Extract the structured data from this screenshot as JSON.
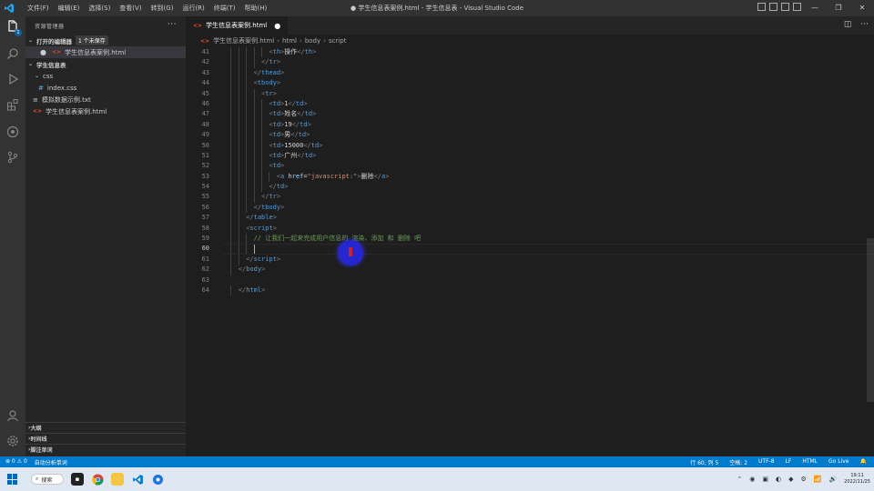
{
  "titlebar": {
    "menu": [
      "文件(F)",
      "编辑(E)",
      "选择(S)",
      "查看(V)",
      "转到(G)",
      "运行(R)",
      "终端(T)",
      "帮助(H)"
    ],
    "title": "● 学生信息表案例.html - 学生信息表 - Visual Studio Code"
  },
  "sidebar": {
    "title": "资源管理器",
    "open_editors": {
      "label": "打开的编辑器",
      "unsaved": "1 个未保存",
      "file": "学生信息表案例.html"
    },
    "project": {
      "label": "学生信息表",
      "folder": "css",
      "files": [
        "index.css",
        "模拟数据示例.txt",
        "学生信息表案例.html"
      ]
    },
    "bottom": [
      "大纲",
      "时间线",
      "脚注单词"
    ]
  },
  "editor": {
    "tab": "学生信息表案例.html",
    "breadcrumb": [
      "学生信息表案例.html",
      "html",
      "body",
      "script"
    ],
    "lines": [
      {
        "n": "41",
        "indent": 6,
        "html": "<span class=\"br\">&lt;</span><span class=\"tag\">th</span><span class=\"br\">&gt;</span>操作<span class=\"br\">&lt;/</span><span class=\"tag\">th</span><span class=\"br\">&gt;</span>"
      },
      {
        "n": "42",
        "indent": 5,
        "html": "<span class=\"br\">&lt;/</span><span class=\"tag\">tr</span><span class=\"br\">&gt;</span>"
      },
      {
        "n": "43",
        "indent": 4,
        "html": "<span class=\"br\">&lt;/</span><span class=\"tag\">thead</span><span class=\"br\">&gt;</span>"
      },
      {
        "n": "44",
        "indent": 4,
        "html": "<span class=\"br\">&lt;</span><span class=\"tag\">tbody</span><span class=\"br\">&gt;</span>"
      },
      {
        "n": "45",
        "indent": 5,
        "html": "<span class=\"br\">&lt;</span><span class=\"tag\">tr</span><span class=\"br\">&gt;</span>"
      },
      {
        "n": "46",
        "indent": 6,
        "html": "<span class=\"br\">&lt;</span><span class=\"tag\">td</span><span class=\"br\">&gt;</span>1<span class=\"br\">&lt;/</span><span class=\"tag\">td</span><span class=\"br\">&gt;</span>"
      },
      {
        "n": "47",
        "indent": 6,
        "html": "<span class=\"br\">&lt;</span><span class=\"tag\">td</span><span class=\"br\">&gt;</span>姓名<span class=\"br\">&lt;/</span><span class=\"tag\">td</span><span class=\"br\">&gt;</span>"
      },
      {
        "n": "48",
        "indent": 6,
        "html": "<span class=\"br\">&lt;</span><span class=\"tag\">td</span><span class=\"br\">&gt;</span>19<span class=\"br\">&lt;/</span><span class=\"tag\">td</span><span class=\"br\">&gt;</span>"
      },
      {
        "n": "49",
        "indent": 6,
        "html": "<span class=\"br\">&lt;</span><span class=\"tag\">td</span><span class=\"br\">&gt;</span>男<span class=\"br\">&lt;/</span><span class=\"tag\">td</span><span class=\"br\">&gt;</span>"
      },
      {
        "n": "50",
        "indent": 6,
        "html": "<span class=\"br\">&lt;</span><span class=\"tag\">td</span><span class=\"br\">&gt;</span>15000<span class=\"br\">&lt;/</span><span class=\"tag\">td</span><span class=\"br\">&gt;</span>"
      },
      {
        "n": "51",
        "indent": 6,
        "html": "<span class=\"br\">&lt;</span><span class=\"tag\">td</span><span class=\"br\">&gt;</span>广州<span class=\"br\">&lt;/</span><span class=\"tag\">td</span><span class=\"br\">&gt;</span>"
      },
      {
        "n": "52",
        "indent": 6,
        "html": "<span class=\"br\">&lt;</span><span class=\"tag\">td</span><span class=\"br\">&gt;</span>"
      },
      {
        "n": "53",
        "indent": 7,
        "html": "<span class=\"br\">&lt;</span><span class=\"tag\">a</span> <span class=\"at\">href</span>=<span class=\"str\">\"javascript:\"</span><span class=\"br\">&gt;</span>删除<span class=\"br\">&lt;/</span><span class=\"tag\">a</span><span class=\"br\">&gt;</span>"
      },
      {
        "n": "54",
        "indent": 6,
        "html": "<span class=\"br\">&lt;/</span><span class=\"tag\">td</span><span class=\"br\">&gt;</span>"
      },
      {
        "n": "55",
        "indent": 5,
        "html": "<span class=\"br\">&lt;/</span><span class=\"tag\">tr</span><span class=\"br\">&gt;</span>"
      },
      {
        "n": "56",
        "indent": 4,
        "html": "<span class=\"br\">&lt;/</span><span class=\"tag\">tbody</span><span class=\"br\">&gt;</span>"
      },
      {
        "n": "57",
        "indent": 3,
        "html": "<span class=\"br\">&lt;/</span><span class=\"tag\">table</span><span class=\"br\">&gt;</span>"
      },
      {
        "n": "58",
        "indent": 3,
        "html": "<span class=\"br\">&lt;</span><span class=\"tag\">script</span><span class=\"br\">&gt;</span>"
      },
      {
        "n": "59",
        "indent": 4,
        "html": "<span class=\"cm\">// 让我们一起来完成用户信息的 渲染、添加 和 删除 吧</span>"
      },
      {
        "n": "60",
        "indent": 4,
        "html": "",
        "current": true
      },
      {
        "n": "61",
        "indent": 3,
        "html": "<span class=\"br\">&lt;/</span><span class=\"tag\">script</span><span class=\"br\">&gt;</span>"
      },
      {
        "n": "62",
        "indent": 2,
        "html": "<span class=\"br\">&lt;/</span><span class=\"tag\">body</span><span class=\"br\">&gt;</span>"
      },
      {
        "n": "63",
        "indent": 0,
        "html": ""
      },
      {
        "n": "64",
        "indent": 2,
        "html": "<span class=\"br\">&lt;/</span><span class=\"tag\">html</span><span class=\"br\">&gt;</span>"
      }
    ]
  },
  "statusbar": {
    "left": [
      "⊗ 0 ⚠ 0",
      "自动分析单词"
    ],
    "right": [
      "行 60, 列 5",
      "空格: 2",
      "UTF-8",
      "LF",
      "HTML",
      "Go Live"
    ]
  },
  "taskbar": {
    "search": "搜索",
    "clock_time": "19:11",
    "clock_date": "2022/11/25"
  },
  "colors": {
    "accent": "#007acc",
    "editor_bg": "#1e1e1e",
    "sidebar_bg": "#252526"
  }
}
